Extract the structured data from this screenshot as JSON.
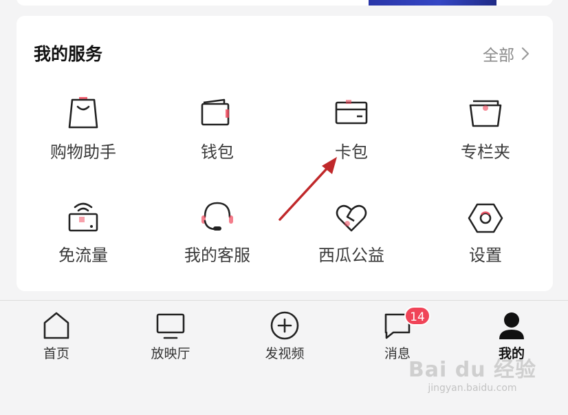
{
  "services": {
    "title": "我的服务",
    "more_label": "全部",
    "items": [
      {
        "label": "购物助手",
        "icon": "shopping-bag-icon"
      },
      {
        "label": "钱包",
        "icon": "wallet-icon"
      },
      {
        "label": "卡包",
        "icon": "card-holder-icon"
      },
      {
        "label": "专栏夹",
        "icon": "folder-icon"
      },
      {
        "label": "免流量",
        "icon": "wifi-router-icon"
      },
      {
        "label": "我的客服",
        "icon": "headset-icon"
      },
      {
        "label": "西瓜公益",
        "icon": "heart-icon"
      },
      {
        "label": "设置",
        "icon": "settings-hexagon-icon"
      }
    ]
  },
  "nav": {
    "tabs": [
      {
        "label": "首页",
        "icon": "home-icon"
      },
      {
        "label": "放映厅",
        "icon": "tv-icon"
      },
      {
        "label": "发视频",
        "icon": "add-video-icon"
      },
      {
        "label": "消息",
        "icon": "message-icon",
        "badge": "14"
      },
      {
        "label": "我的",
        "icon": "profile-icon",
        "active": true
      }
    ]
  },
  "watermark": {
    "logo_text": "Bai du 经验",
    "url": "jingyan.baidu.com"
  },
  "colors": {
    "accent": "#f04458",
    "annotation_arrow": "#c0282a",
    "background": "#f4f4f5",
    "card": "#ffffff"
  }
}
